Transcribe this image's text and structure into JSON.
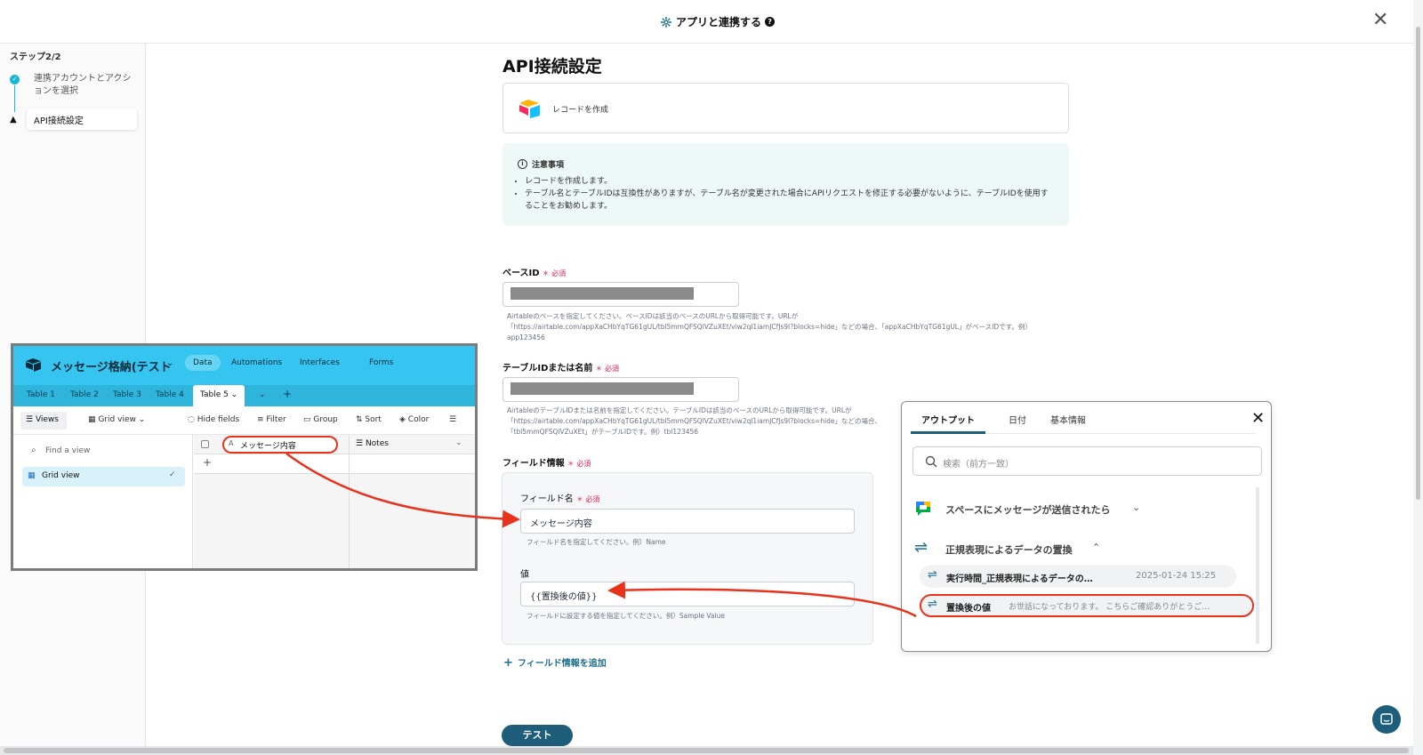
{
  "header": {
    "title": "アプリと連携する",
    "help_icon": "?",
    "close_icon": "✕"
  },
  "sidebar": {
    "step_label": "ステップ2/2",
    "steps": [
      {
        "label": "連携アカウントとアクションを選択",
        "status": "done"
      },
      {
        "label": "API接続設定",
        "status": "current-warning"
      }
    ]
  },
  "page": {
    "title": "API接続設定",
    "action": {
      "label": "レコードを作成"
    },
    "notice": {
      "title": "注意事項",
      "items": [
        "レコードを作成します。",
        "テーブル名とテーブルIDは互換性がありますが、テーブル名が変更された場合にAPIリクエストを修正する必要がないように、テーブルIDを使用することをお勧めします。"
      ]
    },
    "required_mark": "＊ 必須",
    "base_id": {
      "label": "ベースID",
      "hint": "Airtableのベースを指定してください。ベースIDは該当のベースのURLから取得可能です。URLが「https://airtable.com/appXaCHbYqTG61gUL/tbl5mmQFSQlVZuXEt/viw2ql1iamJCfJs9l?blocks=hide」などの場合、「appXaCHbYqTG61gUL」がベースIDです。例）app123456"
    },
    "table_id": {
      "label": "テーブルIDまたは名前",
      "hint": "AirtableのテーブルIDまたは名前を指定してください。テーブルIDは該当のベースのURLから取得可能です。URLが「https://airtable.com/appXaCHbYqTG61gUL/tbl5mmQFSQlVZuXEt/viw2ql1iamJCfJs9l?blocks=hide」などの場合、「tbl5mmQFSQlVZuXEt」がテーブルIDです。例）tbl123456"
    },
    "field_info": {
      "label": "フィールド情報",
      "field_name_label": "フィールド名",
      "field_name_value": "メッセージ内容",
      "field_name_hint": "フィールド名を指定してください。例）Name",
      "value_label": "値",
      "value_value": "{{置換後の値}}",
      "value_hint": "フィールドに設定する値を指定してください。例）Sample Value"
    },
    "add_field": "フィールド情報を追加",
    "test_button": "テスト"
  },
  "output_panel": {
    "tabs": [
      "アウトプット",
      "日付",
      "基本情報"
    ],
    "active_tab": 0,
    "search_placeholder": "検索（前方一致）",
    "groups": [
      {
        "label": "スペースにメッセージが送信されたら",
        "icon": "google-chat-icon",
        "expanded": false
      },
      {
        "label": "正規表現によるデータの置換",
        "icon": "swap-arrows-icon",
        "expanded": true
      }
    ],
    "items": [
      {
        "name": "実行時間_正規表現によるデータの…",
        "value": "2025-01-24 15:25"
      },
      {
        "name": "置換後の値",
        "value": "お世話になっております。 こちらご確認ありがとうご…"
      }
    ]
  },
  "airtable": {
    "base_name": "メッセージ格納(テスト",
    "nav": [
      "Data",
      "Automations",
      "Interfaces",
      "Forms"
    ],
    "tables": [
      "Table 1",
      "Table 2",
      "Table 3",
      "Table 4",
      "Table 5"
    ],
    "toolbar": {
      "views": "Views",
      "grid_view": "Grid view",
      "hide_fields": "Hide fields",
      "filter": "Filter",
      "group": "Group",
      "sort": "Sort",
      "color": "Color"
    },
    "find_view_placeholder": "Find a view",
    "views": [
      "Grid view"
    ],
    "columns": [
      "メッセージ内容",
      "Notes"
    ]
  },
  "colors": {
    "accent": "#1f5e7a",
    "airtable_header": "#36c5f0",
    "highlight": "#e8321c",
    "notice_bg": "#eef8f7"
  }
}
